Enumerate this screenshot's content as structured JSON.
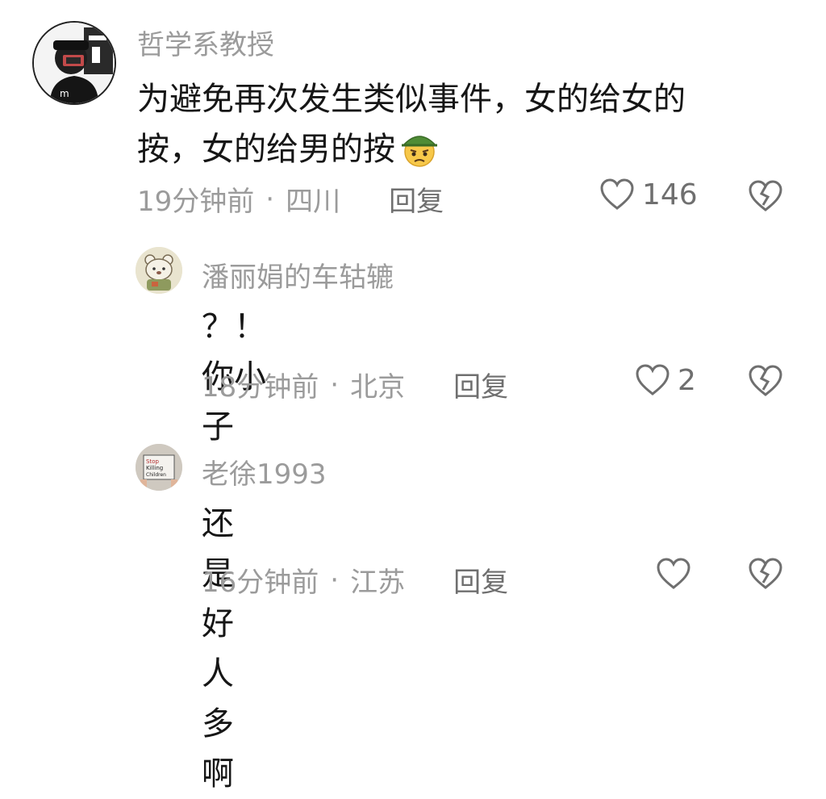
{
  "comments": [
    {
      "username": "哲学系教授",
      "content_line1": "为避免再次发生类似事件，女的给女的",
      "content_line2": "按，女的给男的按",
      "emoji": "frowning-green-cap-emoji",
      "time": "19分钟前",
      "location": "四川",
      "reply_label": "回复",
      "likes": "146",
      "avatar_icon": "man-with-cap-selfie-avatar"
    },
    {
      "username": "潘丽娟的车轱辘",
      "content": "？！ 你小子",
      "time": "18分钟前",
      "location": "北京",
      "reply_label": "回复",
      "likes": "2",
      "avatar_icon": "cartoon-bear-avatar"
    },
    {
      "username": "老徐1993",
      "content": "还是好人多啊",
      "time": "16分钟前",
      "location": "江苏",
      "reply_label": "回复",
      "likes": "",
      "avatar_icon": "sign-holding-avatar",
      "avatar_text": "Stop Killing Children"
    }
  ],
  "separator": "·",
  "colors": {
    "meta_gray": "#9b9b9b",
    "text": "#161616",
    "icon_gray": "#6f6f6f"
  }
}
